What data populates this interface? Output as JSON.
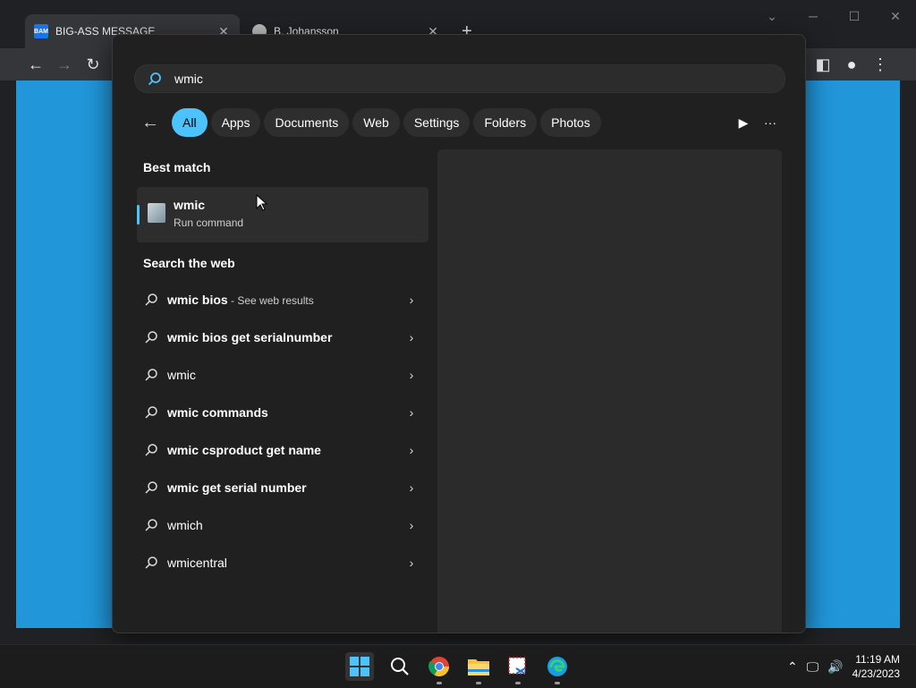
{
  "browser": {
    "tabs": [
      {
        "favicon": "BAM",
        "title": "BIG-ASS MESSAGE",
        "active": true
      },
      {
        "favicon": "",
        "title": "B. Johansson",
        "active": false
      }
    ]
  },
  "search": {
    "query": "wmic",
    "filters": [
      "All",
      "Apps",
      "Documents",
      "Web",
      "Settings",
      "Folders",
      "Photos"
    ],
    "best_match_title": "Best match",
    "best_match": {
      "name": "wmic",
      "subtitle": "Run command"
    },
    "web_title": "Search the web",
    "web_results": [
      {
        "text": "wmic bios",
        "extra": " - See web results"
      },
      {
        "text": "wmic bios get serialnumber",
        "extra": ""
      },
      {
        "text": "wmic",
        "extra": ""
      },
      {
        "text": "wmic commands",
        "extra": ""
      },
      {
        "text": "wmic csproduct get name",
        "extra": ""
      },
      {
        "text": "wmic get serial number",
        "extra": ""
      },
      {
        "text": "wmich",
        "extra": ""
      },
      {
        "text": "wmicentral",
        "extra": ""
      }
    ]
  },
  "taskbar": {
    "time": "11:19 AM",
    "date": "4/23/2023"
  },
  "colors": {
    "accent": "#4cc2ff",
    "page_bg": "#2196d9"
  }
}
